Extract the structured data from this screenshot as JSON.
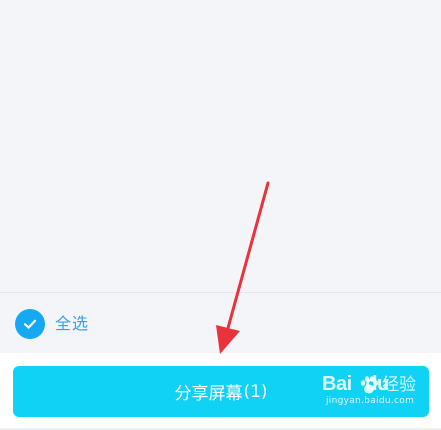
{
  "select_all": {
    "label": "全选",
    "checked": true,
    "icon": "check-icon",
    "color": "#14a9f2"
  },
  "share_button": {
    "label": "分享屏幕",
    "count": "(1)",
    "color": "#0fd2f5"
  },
  "annotation": {
    "type": "arrow",
    "color": "#e8323c"
  },
  "watermark": {
    "brand": "Bai",
    "brand_suffix": "du",
    "product": "经验",
    "url": "jingyan.baidu.com"
  }
}
